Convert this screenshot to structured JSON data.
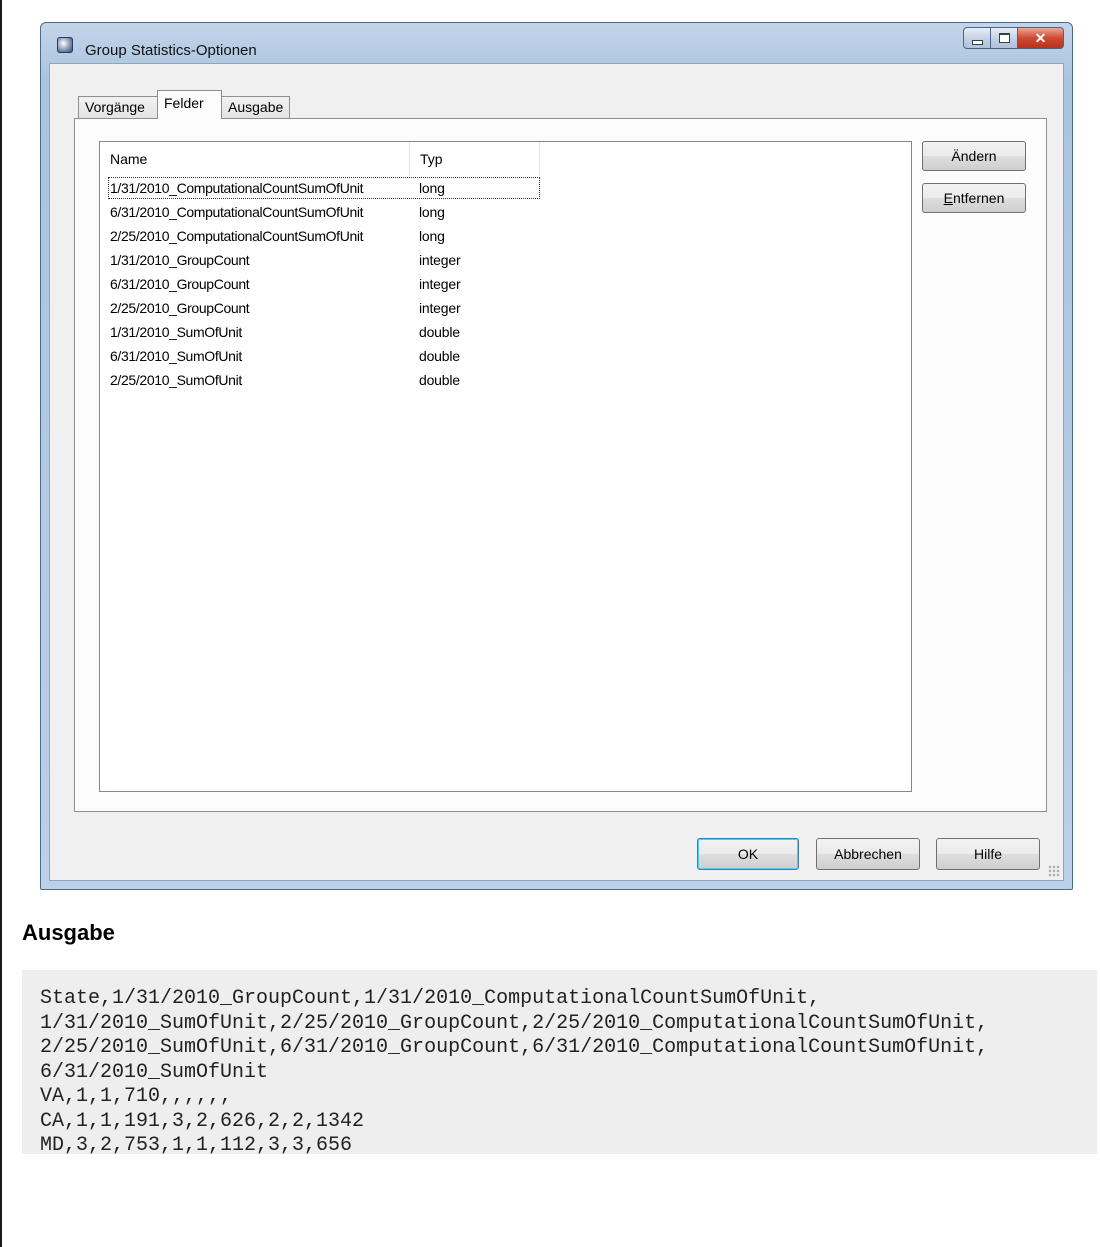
{
  "window": {
    "title": "Group Statistics-Optionen",
    "icon": "app-icon",
    "caption_buttons": {
      "minimize": "minimize-icon",
      "maximize": "maximize-icon",
      "close": "✕"
    }
  },
  "tabs": [
    {
      "label": "Vorgänge",
      "active": false
    },
    {
      "label": "Felder",
      "active": true
    },
    {
      "label": "Ausgabe",
      "active": false
    }
  ],
  "fields_list": {
    "columns": [
      "Name",
      "Typ"
    ],
    "rows": [
      {
        "name": "1/31/2010_ComputationalCountSumOfUnit",
        "type": "long",
        "focused": true
      },
      {
        "name": "6/31/2010_ComputationalCountSumOfUnit",
        "type": "long"
      },
      {
        "name": "2/25/2010_ComputationalCountSumOfUnit",
        "type": "long"
      },
      {
        "name": "1/31/2010_GroupCount",
        "type": "integer"
      },
      {
        "name": "6/31/2010_GroupCount",
        "type": "integer"
      },
      {
        "name": "2/25/2010_GroupCount",
        "type": "integer"
      },
      {
        "name": "1/31/2010_SumOfUnit",
        "type": "double"
      },
      {
        "name": "6/31/2010_SumOfUnit",
        "type": "double"
      },
      {
        "name": "2/25/2010_SumOfUnit",
        "type": "double"
      }
    ]
  },
  "side_buttons": {
    "change": "Ändern",
    "remove_mnemonic": "E",
    "remove_rest": "ntfernen"
  },
  "footer_buttons": {
    "ok": "OK",
    "cancel": "Abbrechen",
    "help": "Hilfe"
  },
  "output": {
    "heading": "Ausgabe",
    "lines": [
      "State,1/31/2010_GroupCount,1/31/2010_ComputationalCountSumOfUnit,",
      "1/31/2010_SumOfUnit,2/25/2010_GroupCount,2/25/2010_ComputationalCountSumOfUnit,",
      "2/25/2010_SumOfUnit,6/31/2010_GroupCount,6/31/2010_ComputationalCountSumOfUnit,",
      "6/31/2010_SumOfUnit",
      "VA,1,1,710,,,,,,",
      "CA,1,1,191,3,2,626,2,2,1342",
      "MD,3,2,753,1,1,112,3,3,656"
    ]
  }
}
